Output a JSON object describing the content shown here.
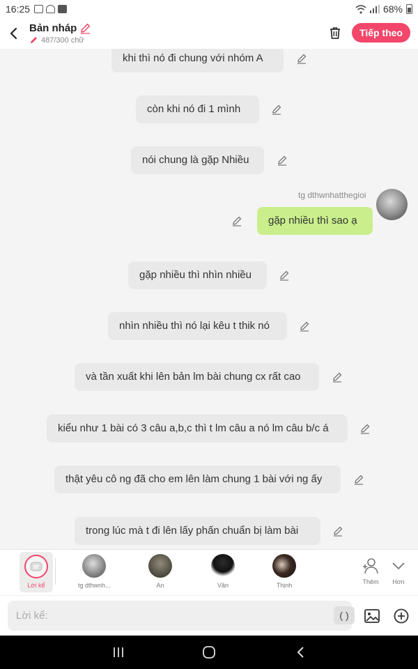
{
  "status_bar": {
    "time": "16:25",
    "battery": "68%"
  },
  "header": {
    "title": "Bản nháp",
    "word_count": "487/300 chữ",
    "next_label": "Tiếp theo"
  },
  "messages": [
    {
      "text": "khi thì nó đi chung với nhóm A",
      "side": "narration"
    },
    {
      "text": "còn khi nó đi 1 mình",
      "side": "narration"
    },
    {
      "text": "nói chung là gặp Nhiều",
      "side": "narration"
    },
    {
      "text": "gặp nhiều thì sao ạ",
      "side": "right",
      "sender": "tg dthwnhatthegioi"
    },
    {
      "text": "gặp nhiều thì nhìn nhiều",
      "side": "narration"
    },
    {
      "text": "nhìn nhiều thì nó lại kêu t thik nó",
      "side": "narration"
    },
    {
      "text": "và tần xuất khi lên bản lm bài chung cx rất cao",
      "side": "narration"
    },
    {
      "text": "kiểu như 1 bài có 3 câu a,b,c thì t lm câu a nó lm câu b/c á",
      "side": "narration"
    },
    {
      "text": "thật yêu cô ng đã cho em lên làm chung 1 bài với ng ấy",
      "side": "narration"
    },
    {
      "text": "trong lúc mà t đi lên lấy phấn chuẩn bị làm bài",
      "side": "narration"
    }
  ],
  "characters": {
    "narration_label": "Lời kể",
    "items": [
      {
        "name": "tg dthwnh..."
      },
      {
        "name": "An"
      },
      {
        "name": "Vân"
      },
      {
        "name": "Thịnh"
      }
    ],
    "add_label": "Thêm",
    "more_label": "Hơn"
  },
  "input": {
    "placeholder": "Lời kể:",
    "paren_label": "( )"
  },
  "colors": {
    "accent": "#f2466a",
    "my_bubble": "#c9ee8b",
    "bubble": "#e9e9ea"
  }
}
